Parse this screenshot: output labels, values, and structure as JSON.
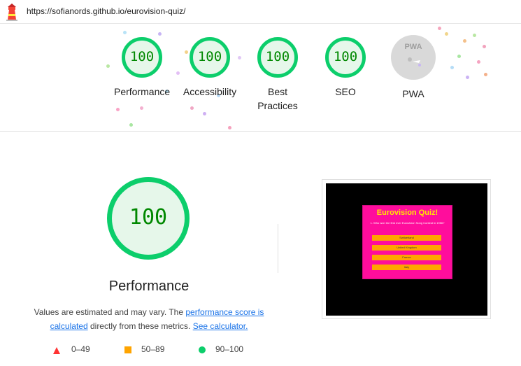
{
  "topbar": {
    "url": "https://sofianords.github.io/eurovision-quiz/"
  },
  "colors": {
    "pass_green": "#0cce6b",
    "score_green": "#008800",
    "fail_red": "#ff3333",
    "average_orange": "#ffa400",
    "link_blue": "#1a73e8"
  },
  "icons": {
    "lighthouse": "lighthouse-icon"
  },
  "categories": [
    {
      "score": "100",
      "label": "Performance"
    },
    {
      "score": "100",
      "label": "Accessibility"
    },
    {
      "score": "100",
      "label": "Best Practices"
    },
    {
      "score": "100",
      "label": "SEO"
    },
    {
      "label": "PWA",
      "badge": "PWA"
    }
  ],
  "performance": {
    "score": "100",
    "title": "Performance",
    "note_prefix": "Values are estimated and may vary. The ",
    "link_score": "performance score is calculated",
    "note_middle": " directly from these metrics. ",
    "link_calc": "See calculator."
  },
  "legend": [
    {
      "label": "0–49"
    },
    {
      "label": "50–89"
    },
    {
      "label": "90–100"
    }
  ],
  "screenshot": {
    "title": "Eurovision Quiz!",
    "question": "1. Who won the first ever Eurovision Song Contest in 1956?",
    "options": [
      "Switzerland",
      "United Kingdom",
      "France",
      "Italy"
    ]
  }
}
